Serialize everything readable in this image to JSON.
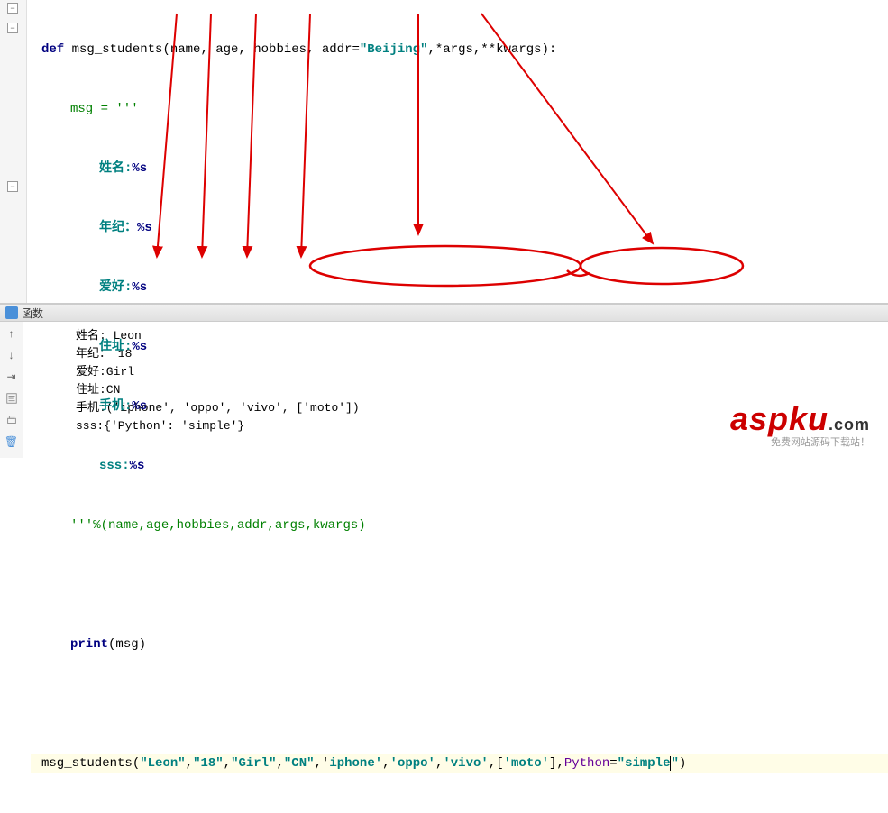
{
  "code": {
    "line1": {
      "def": "def ",
      "fn": "msg_students",
      "params_pre": "(name, age, hobbies, addr=",
      "default": "\"Beijing\"",
      "params_post": ",*args,**kwargs):"
    },
    "line2": "msg = '''",
    "line3": {
      "label": "姓名:",
      "fmt": "%s"
    },
    "line4": {
      "label": "年纪：",
      "fmt": "%s"
    },
    "line5": {
      "label": "爱好:",
      "fmt": "%s"
    },
    "line6": {
      "label": "住址:",
      "fmt": "%s"
    },
    "line7": {
      "label": "手机:",
      "fmt": "%s"
    },
    "line8": {
      "label": "sss:",
      "fmt": "%s"
    },
    "line9": "'''%(name,age,hobbies,addr,args,kwargs)",
    "line10": "",
    "line11": {
      "fn": "print",
      "args": "(msg)"
    },
    "line12": "",
    "line13": {
      "fn": "msg_students",
      "lp": "(",
      "a1": "\"Leon\"",
      "c": ",",
      "a2": "\"18\"",
      "a3": "\"Girl\"",
      "a4": "\"CN\"",
      "ap": "'",
      "a5": "iphone'",
      "a6": "'oppo'",
      "a7": "'vivo'",
      "lb": "[",
      "a8": "'moto'",
      "rb": "]",
      "kw": "Python",
      "eq": "=",
      "a9": "\"simple",
      "rp": "\")"
    }
  },
  "panel": {
    "title": "函数"
  },
  "output": {
    "l1": "姓名: Leon",
    "l2": "年纪： 18",
    "l3": "爱好:Girl",
    "l4": "住址:CN",
    "l5": "手机:('iphone', 'oppo', 'vivo', ['moto'])",
    "l6": "sss:{'Python': 'simple'}"
  },
  "watermark": {
    "main": "aspku",
    "ext": ".com",
    "sub": "免费网站源码下载站！"
  }
}
